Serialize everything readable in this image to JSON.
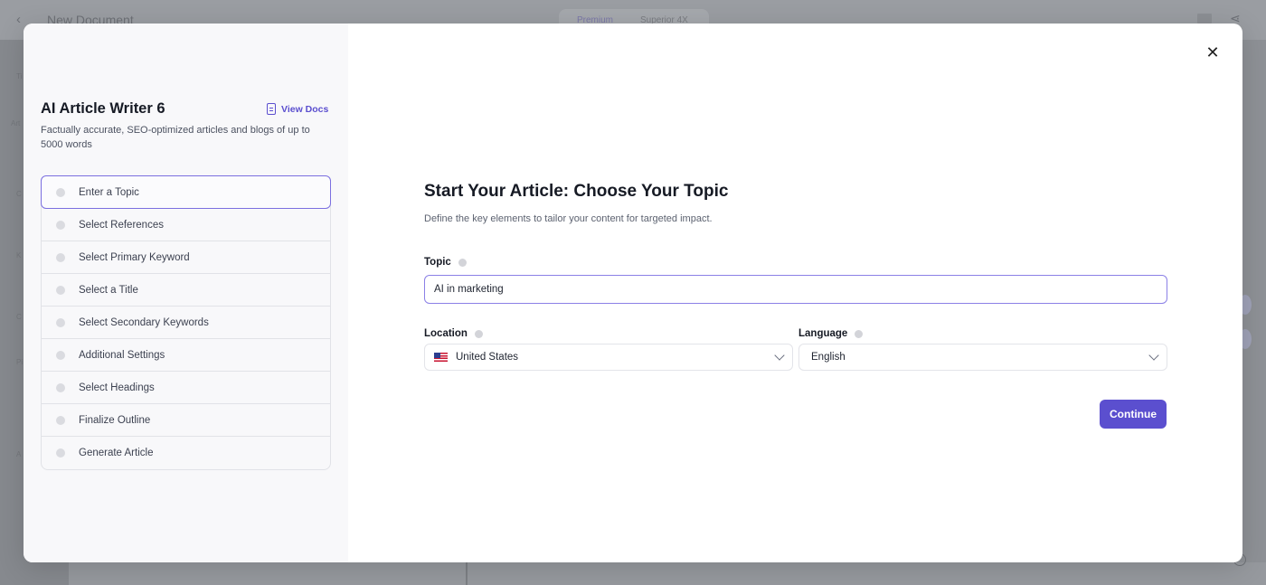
{
  "background": {
    "doc_title": "New Document",
    "tabs": [
      "Premium",
      "Superior 4X"
    ],
    "side_labels": [
      "Ti",
      "Art",
      "C",
      "K",
      "C",
      "Pi",
      "A"
    ]
  },
  "panel": {
    "title": "AI Article Writer 6",
    "view_docs_label": "View Docs",
    "description": "Factually accurate, SEO-optimized articles and blogs of up to 5000 words",
    "steps": [
      {
        "label": "Enter a Topic"
      },
      {
        "label": "Select References"
      },
      {
        "label": "Select Primary Keyword"
      },
      {
        "label": "Select a Title"
      },
      {
        "label": "Select Secondary Keywords"
      },
      {
        "label": "Additional Settings"
      },
      {
        "label": "Select Headings"
      },
      {
        "label": "Finalize Outline"
      },
      {
        "label": "Generate Article"
      }
    ]
  },
  "main": {
    "title": "Start Your Article: Choose Your Topic",
    "subtitle": "Define the key elements to tailor your content for targeted impact.",
    "topic": {
      "label": "Topic",
      "value": "AI in marketing"
    },
    "location": {
      "label": "Location",
      "value": "United States"
    },
    "language": {
      "label": "Language",
      "value": "English"
    },
    "continue_label": "Continue"
  },
  "colors": {
    "accent": "#5b4fcf",
    "active_border": "#7b6fe0"
  }
}
